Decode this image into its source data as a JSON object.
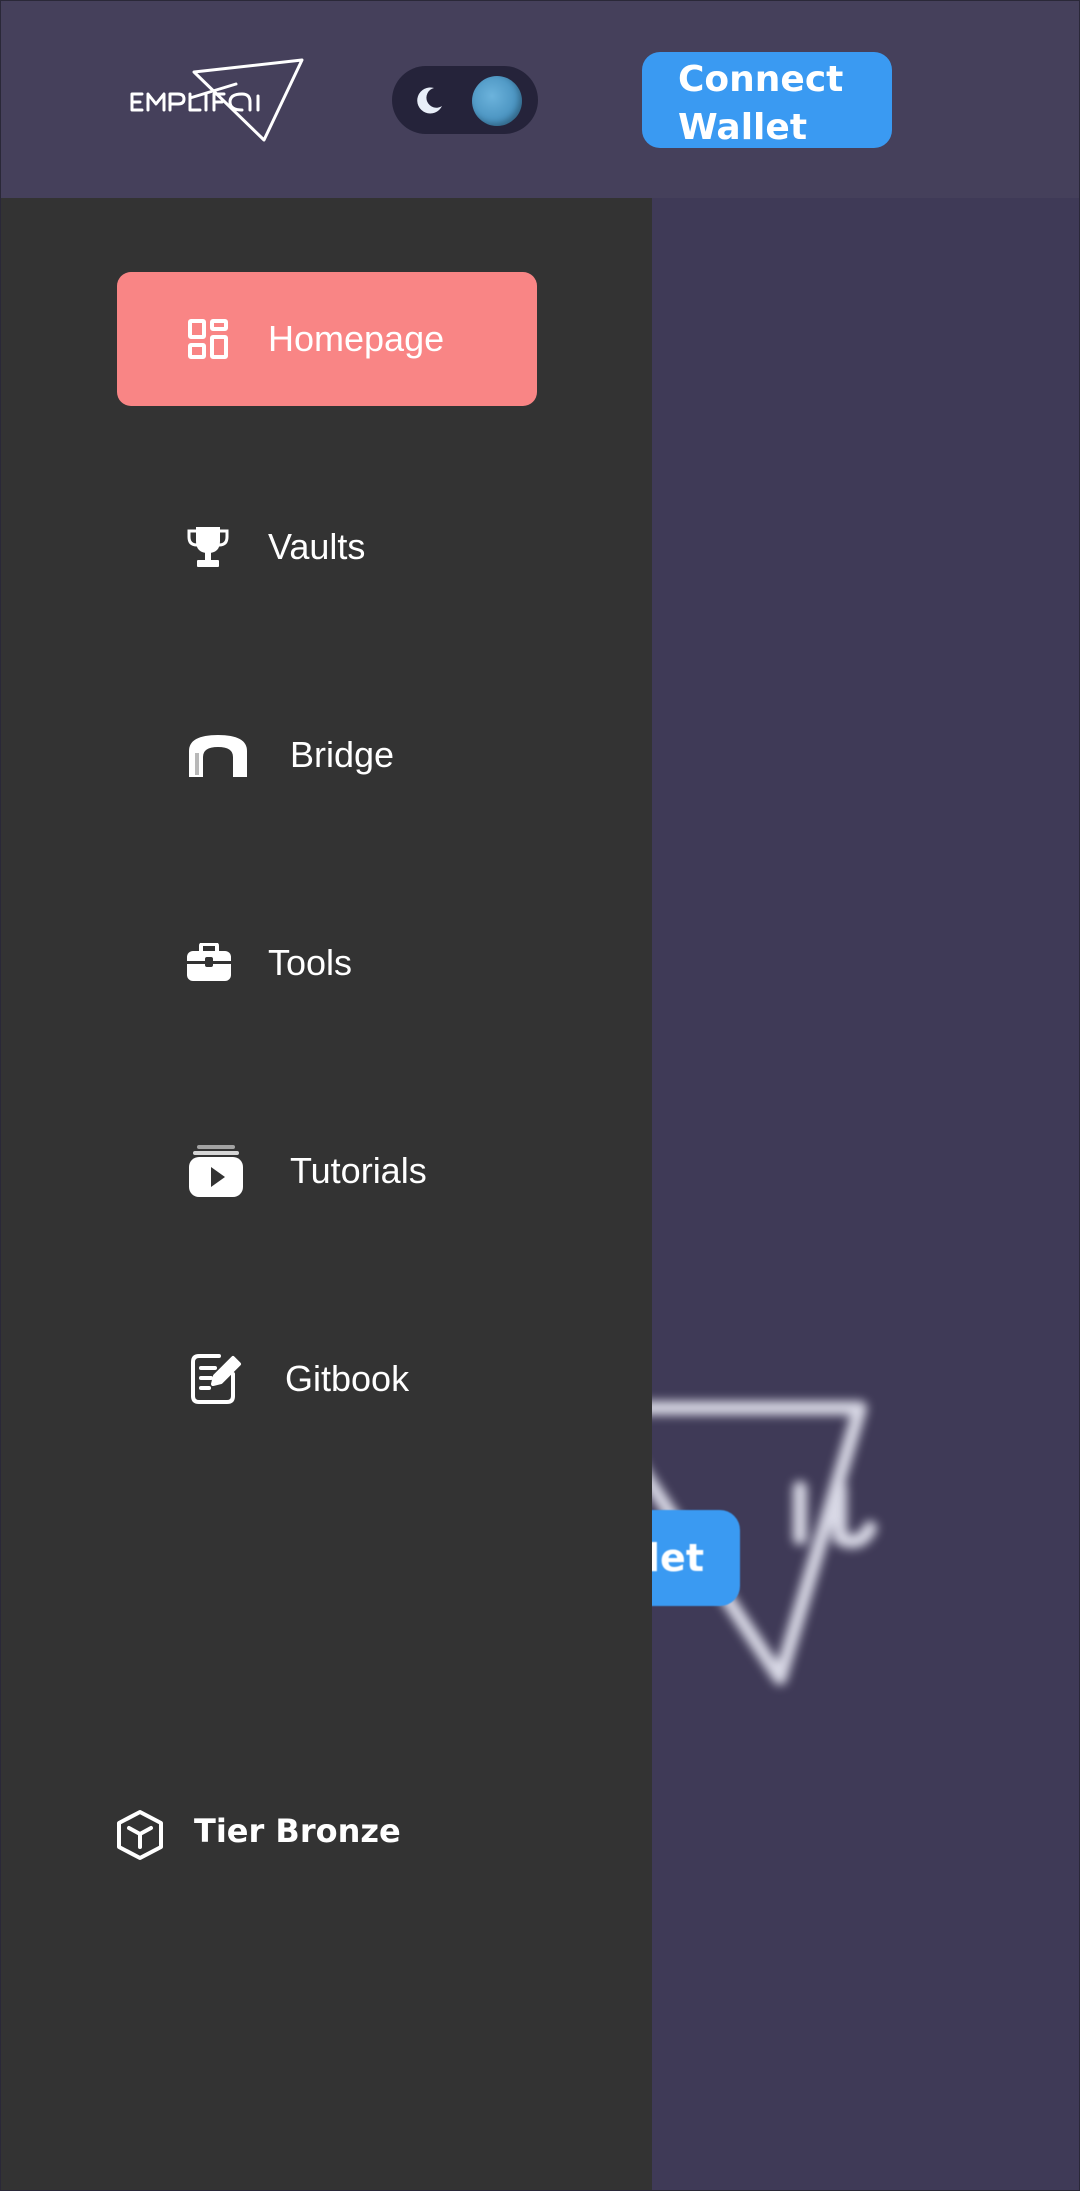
{
  "header": {
    "logo_text": "EMPLIFAI",
    "connect_wallet_line1": "Connect",
    "connect_wallet_line2": "Wallet"
  },
  "theme_toggle": {
    "mode": "dark",
    "icon": "moon-icon"
  },
  "sidebar": {
    "items": [
      {
        "label": "Homepage",
        "icon": "dashboard-grid-icon",
        "active": true
      },
      {
        "label": "Vaults",
        "icon": "trophy-icon",
        "active": false
      },
      {
        "label": "Bridge",
        "icon": "bridge-arch-icon",
        "active": false
      },
      {
        "label": "Tools",
        "icon": "toolbox-icon",
        "active": false
      },
      {
        "label": "Tutorials",
        "icon": "video-play-icon",
        "active": false
      },
      {
        "label": "Gitbook",
        "icon": "edit-document-icon",
        "active": false
      }
    ],
    "tier_label": "Tier Bronze",
    "tier_icon": "cube-icon"
  },
  "background": {
    "blurred_button_text": "let"
  },
  "colors": {
    "header_bg": "#45405b",
    "page_bg": "#3f3a57",
    "sidebar_bg": "#333333",
    "active_item_bg": "#f98585",
    "accent_blue": "#3a9af2"
  }
}
